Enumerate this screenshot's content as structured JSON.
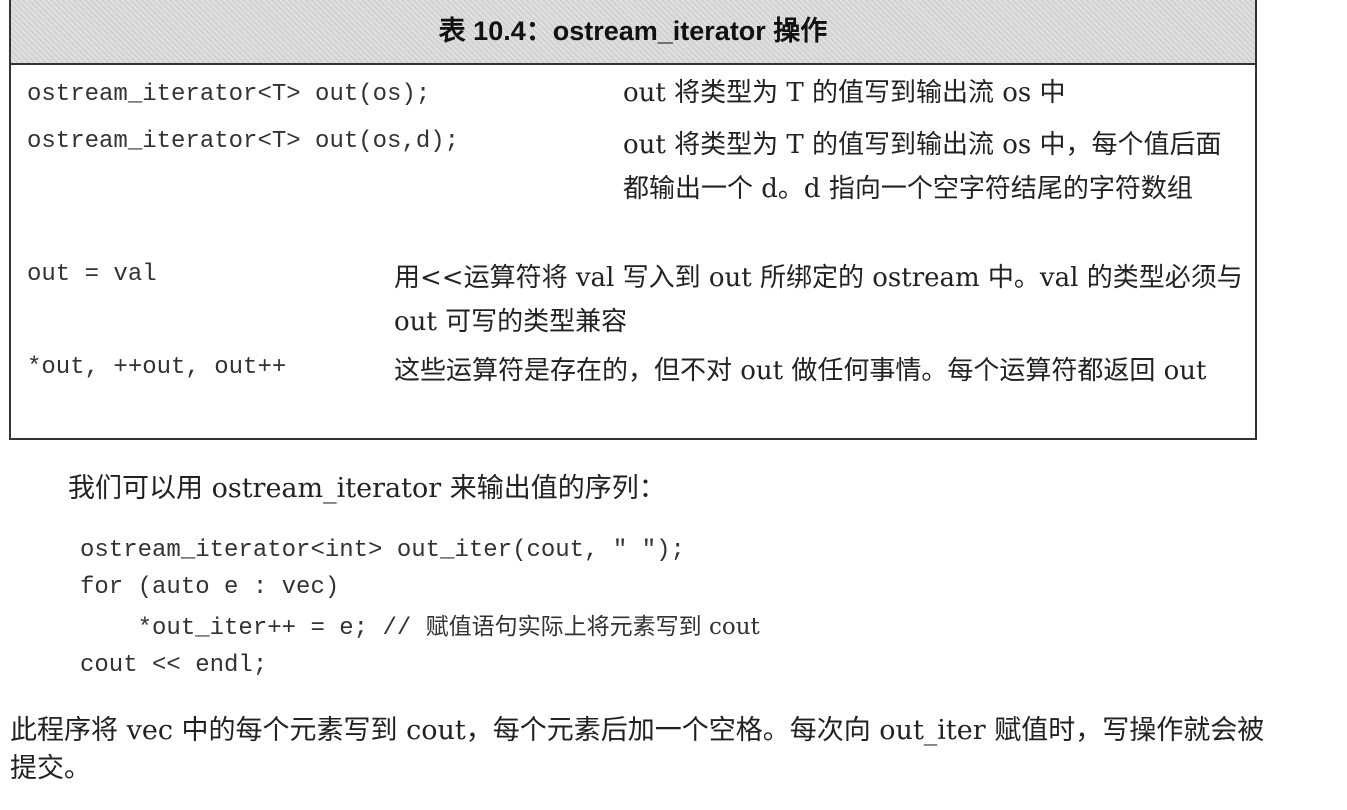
{
  "table": {
    "title": "表 10.4：ostream_iterator 操作",
    "rows": [
      {
        "op": "ostream_iterator<T> out(os);",
        "desc": "out 将类型为 T 的值写到输出流 os 中"
      },
      {
        "op": "ostream_iterator<T> out(os,d);",
        "desc": "out 将类型为 T 的值写到输出流 os 中，每个值后面都输出一个 d。d 指向一个空字符结尾的字符数组"
      },
      {
        "op": "out = val",
        "desc": "用<<运算符将 val 写入到 out 所绑定的 ostream 中。val 的类型必须与 out 可写的类型兼容"
      },
      {
        "op": "*out, ++out, out++",
        "desc": "这些运算符是存在的，但不对 out 做任何事情。每个运算符都返回 out"
      }
    ]
  },
  "intro": "我们可以用 ostream_iterator 来输出值的序列：",
  "code": {
    "line1": "ostream_iterator<int> out_iter(cout, \" \");",
    "line2": "for (auto e : vec)",
    "line3_code": "    *out_iter++ = e; // ",
    "line3_comment": "赋值语句实际上将元素写到 cout",
    "line4": "cout << endl;"
  },
  "closing": "此程序将 vec 中的每个元素写到 cout，每个元素后加一个空格。每次向 out_iter 赋值时，写操作就会被提交。"
}
